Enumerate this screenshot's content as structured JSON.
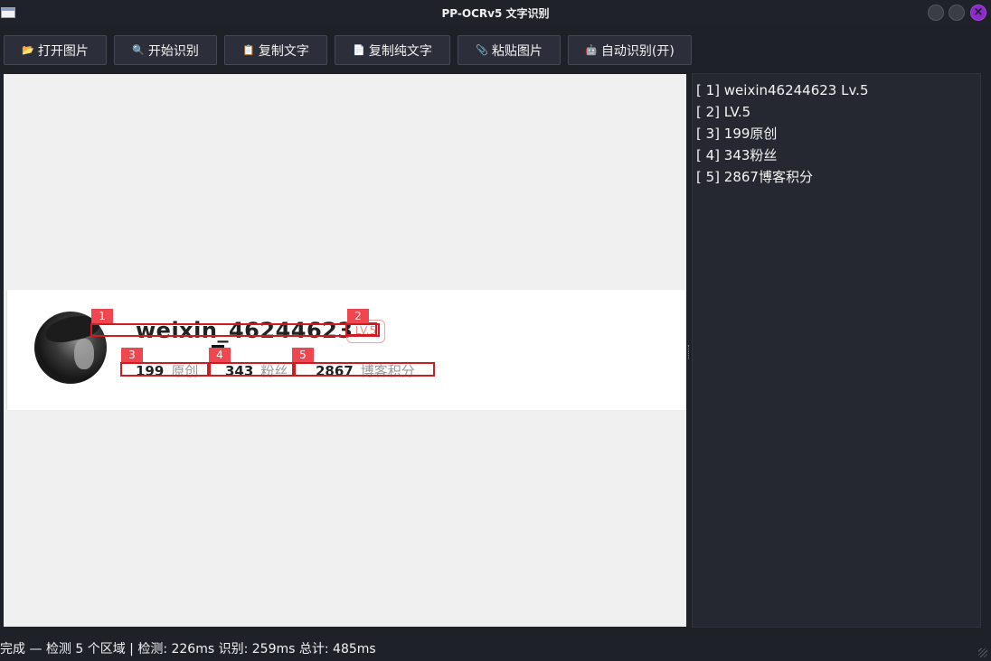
{
  "window": {
    "title": "PP-OCRv5 文字识别"
  },
  "toolbar": {
    "buttons": [
      {
        "icon": "📂",
        "icon_name": "folder-open-icon",
        "label": "打开图片"
      },
      {
        "icon": "🔍",
        "icon_name": "magnifier-icon",
        "label": "开始识别"
      },
      {
        "icon": "📋",
        "icon_name": "clipboard-icon",
        "label": "复制文字"
      },
      {
        "icon": "📄",
        "icon_name": "document-icon",
        "label": "复制纯文字"
      },
      {
        "icon": "📎",
        "icon_name": "paperclip-icon",
        "label": "粘贴图片"
      },
      {
        "icon": "🤖",
        "icon_name": "robot-icon",
        "label": "自动识别(开)"
      }
    ]
  },
  "image": {
    "username": "weixin_46244623",
    "level_badge": "LV.5",
    "stats": [
      {
        "value": "199",
        "label": "原创"
      },
      {
        "value": "343",
        "label": "粉丝"
      },
      {
        "value": "2867",
        "label": "博客积分"
      }
    ],
    "box_labels": [
      "1",
      "2",
      "3",
      "4",
      "5"
    ]
  },
  "results": {
    "lines": [
      "[ 1] weixin46244623 Lv.5",
      "[ 2] LV.5",
      "[ 3] 199原创",
      "[ 4] 343粉丝",
      "[ 5] 2867博客积分"
    ]
  },
  "status": {
    "text": "完成 — 检测 5 个区域 | 检测: 226ms  识别: 259ms  总计: 485ms"
  },
  "colors": {
    "box": "#d11b22",
    "box_label_bg": "#f0464f",
    "close_button": "#8b2cc9"
  }
}
